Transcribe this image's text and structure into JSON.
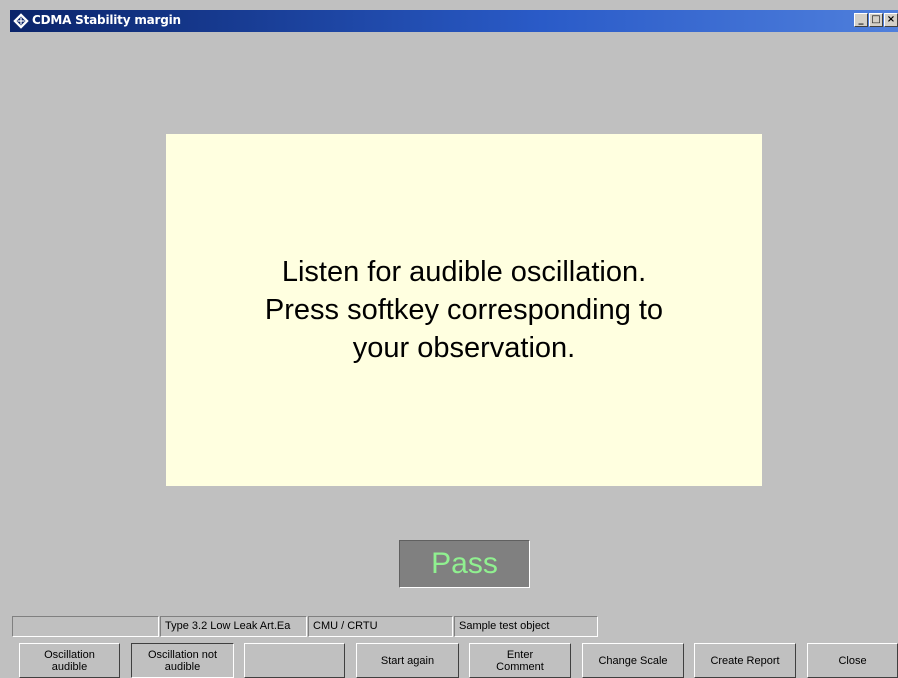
{
  "window": {
    "title": "CDMA Stability margin",
    "minimize_glyph": "_",
    "maximize_glyph": "□",
    "close_glyph": "×"
  },
  "message": {
    "line1": "Listen for audible oscillation.",
    "line2": "Press softkey corresponding to",
    "line3": "your observation."
  },
  "result": {
    "label": "Pass",
    "color": "#90f090"
  },
  "status_bar": {
    "field1": "",
    "field2": "Type 3.2 Low Leak Art.Ea",
    "field3": "CMU / CRTU",
    "field4": "Sample test object"
  },
  "softkeys": {
    "k1": "Oscillation\naudible",
    "k2": "Oscillation not\naudible",
    "k3": "",
    "k4": "Start again",
    "k5": "Enter\nComment",
    "k6": "Change Scale",
    "k7": "Create Report",
    "k8": "Close"
  },
  "icons": {
    "app": "diamond-logo-icon"
  }
}
